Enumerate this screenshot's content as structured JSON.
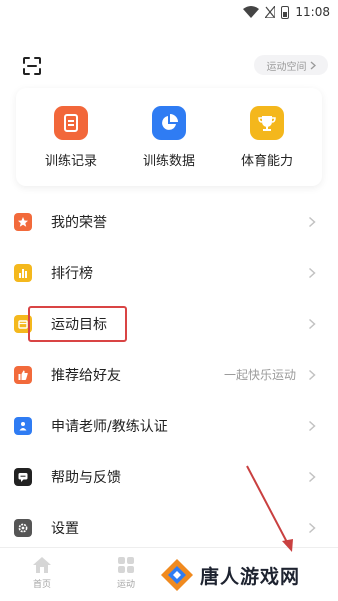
{
  "status_bar": {
    "time": "11:08"
  },
  "header": {
    "space_button_label": "运动空间"
  },
  "quick_actions": [
    {
      "label": "训练记录",
      "icon": "clipboard-icon",
      "color": "#f2673a"
    },
    {
      "label": "训练数据",
      "icon": "pie-chart-icon",
      "color": "#2f7cf3"
    },
    {
      "label": "体育能力",
      "icon": "trophy-icon",
      "color": "#f4b71c"
    }
  ],
  "menu": [
    {
      "label": "我的荣誉",
      "icon": "star-badge-icon",
      "color": "#f26a3b",
      "hint": ""
    },
    {
      "label": "排行榜",
      "icon": "bar-chart-icon",
      "color": "#f4b81d",
      "hint": ""
    },
    {
      "label": "运动目标",
      "icon": "target-card-icon",
      "color": "#f4b81d",
      "hint": ""
    },
    {
      "label": "推荐给好友",
      "icon": "thumbs-up-icon",
      "color": "#f26a3b",
      "hint": "一起快乐运动"
    },
    {
      "label": "申请老师/教练认证",
      "icon": "id-badge-icon",
      "color": "#2f7cf3",
      "hint": ""
    },
    {
      "label": "帮助与反馈",
      "icon": "chat-bubble-icon",
      "color": "#222222",
      "hint": ""
    },
    {
      "label": "设置",
      "icon": "gear-icon",
      "color": "#555555",
      "hint": ""
    }
  ],
  "tabbar": {
    "home_label": "首页",
    "sport_label": "运动"
  },
  "watermark": {
    "text": "唐人游戏网"
  }
}
